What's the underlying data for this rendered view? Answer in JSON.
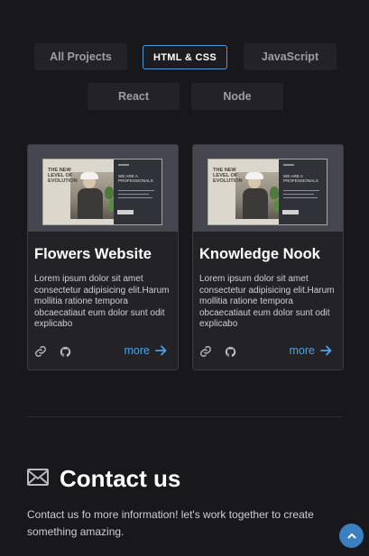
{
  "filters": [
    {
      "label": "All Projects",
      "active": false
    },
    {
      "label": "HTML & CSS",
      "active": true
    },
    {
      "label": "JavaScript",
      "active": false
    },
    {
      "label": "React",
      "active": false
    },
    {
      "label": "Node",
      "active": false
    }
  ],
  "projects": [
    {
      "title": "Flowers Website",
      "description": "Lorem ipsum dolor sit amet consectetur adipisicing elit.Harum mollitia ratione tempora obcaecatiaut eum dolor sunt odit explicabo",
      "more_label": "more",
      "thumbnail": {
        "headline": "THE NEW LEVEL OF EVOLUTION",
        "side_text": "WE ARE A PROFESSIONALS"
      }
    },
    {
      "title": "Knowledge Nook",
      "description": "Lorem ipsum dolor sit amet consectetur adipisicing elit.Harum mollitia ratione tempora obcaecatiaut eum dolor sunt odit explicabo",
      "more_label": "more",
      "thumbnail": {
        "headline": "THE NEW LEVEL OF EVOLUTION",
        "side_text": "WE ARE A PROFESSIONALS"
      }
    }
  ],
  "contact": {
    "title": "Contact us",
    "text": "Contact us fo more information! let's work together to create something amazing."
  },
  "icons": {
    "link": "link-icon",
    "github": "github-icon",
    "arrow": "arrow-right-icon",
    "mail": "envelope-icon",
    "scroll": "chevron-up-icon"
  },
  "colors": {
    "background": "#18171b",
    "card": "#222227",
    "accent": "#4aa3e8",
    "active_border": "#4d9ad6",
    "scroll_button": "#3a7fc0"
  }
}
